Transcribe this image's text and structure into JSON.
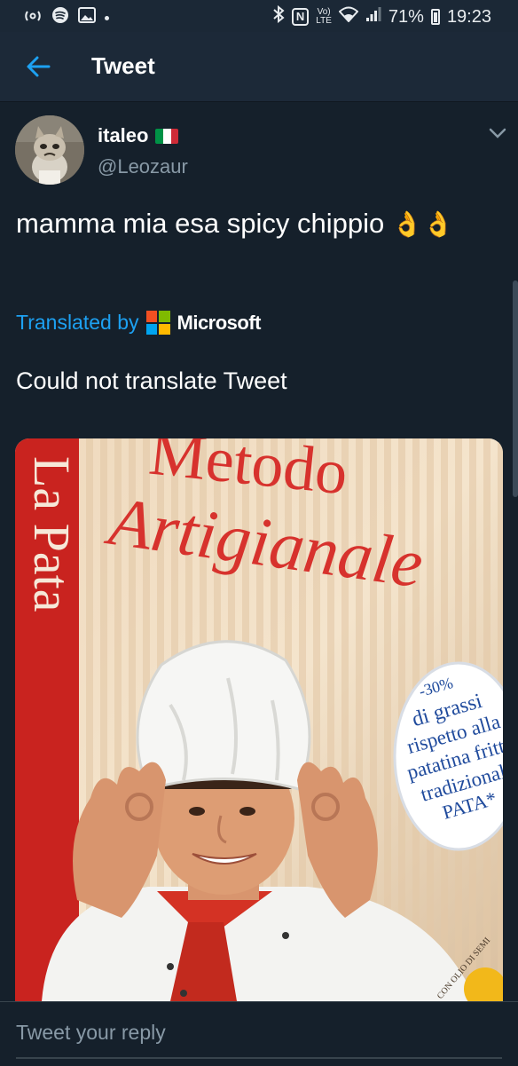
{
  "status_bar": {
    "left_icons": [
      "hotspot-icon",
      "spotify-icon",
      "gallery-icon"
    ],
    "right_icons": [
      "bluetooth-icon",
      "nfc-icon",
      "volte-icon",
      "wifi-icon",
      "signal-icon",
      "battery-icon"
    ],
    "nfc_glyph": "N",
    "volte_line1": "Vo)",
    "volte_line2": "LTE",
    "battery_percent": "71%",
    "time": "19:23"
  },
  "header": {
    "back_icon": "arrow-left-icon",
    "title": "Tweet"
  },
  "tweet": {
    "display_name": "italeo",
    "flag_icon": "italy-flag-icon",
    "handle": "@Leozaur",
    "text": "mamma mia esa spicy chippio",
    "emoji": "👌👌",
    "translated_by_label": "Translated by",
    "translator_logo": "microsoft-logo",
    "translator_name": "Microsoft",
    "translation_status": "Could not translate Tweet"
  },
  "media": {
    "bag_heading_top": "Metodo",
    "bag_heading": "Artigianale",
    "brand_side_text": "La Pata",
    "badge_lines": [
      "-30%",
      "di grassi",
      "rispetto alla",
      "patatina fritta",
      "tradizionale",
      "PATA*"
    ],
    "bottom_text": "CON OLIO DI SEMI"
  },
  "reply": {
    "placeholder": "Tweet your reply"
  },
  "colors": {
    "background": "#15202b",
    "header": "#1c2938",
    "accent": "#1da1f2",
    "secondary_text": "#8899a6"
  }
}
